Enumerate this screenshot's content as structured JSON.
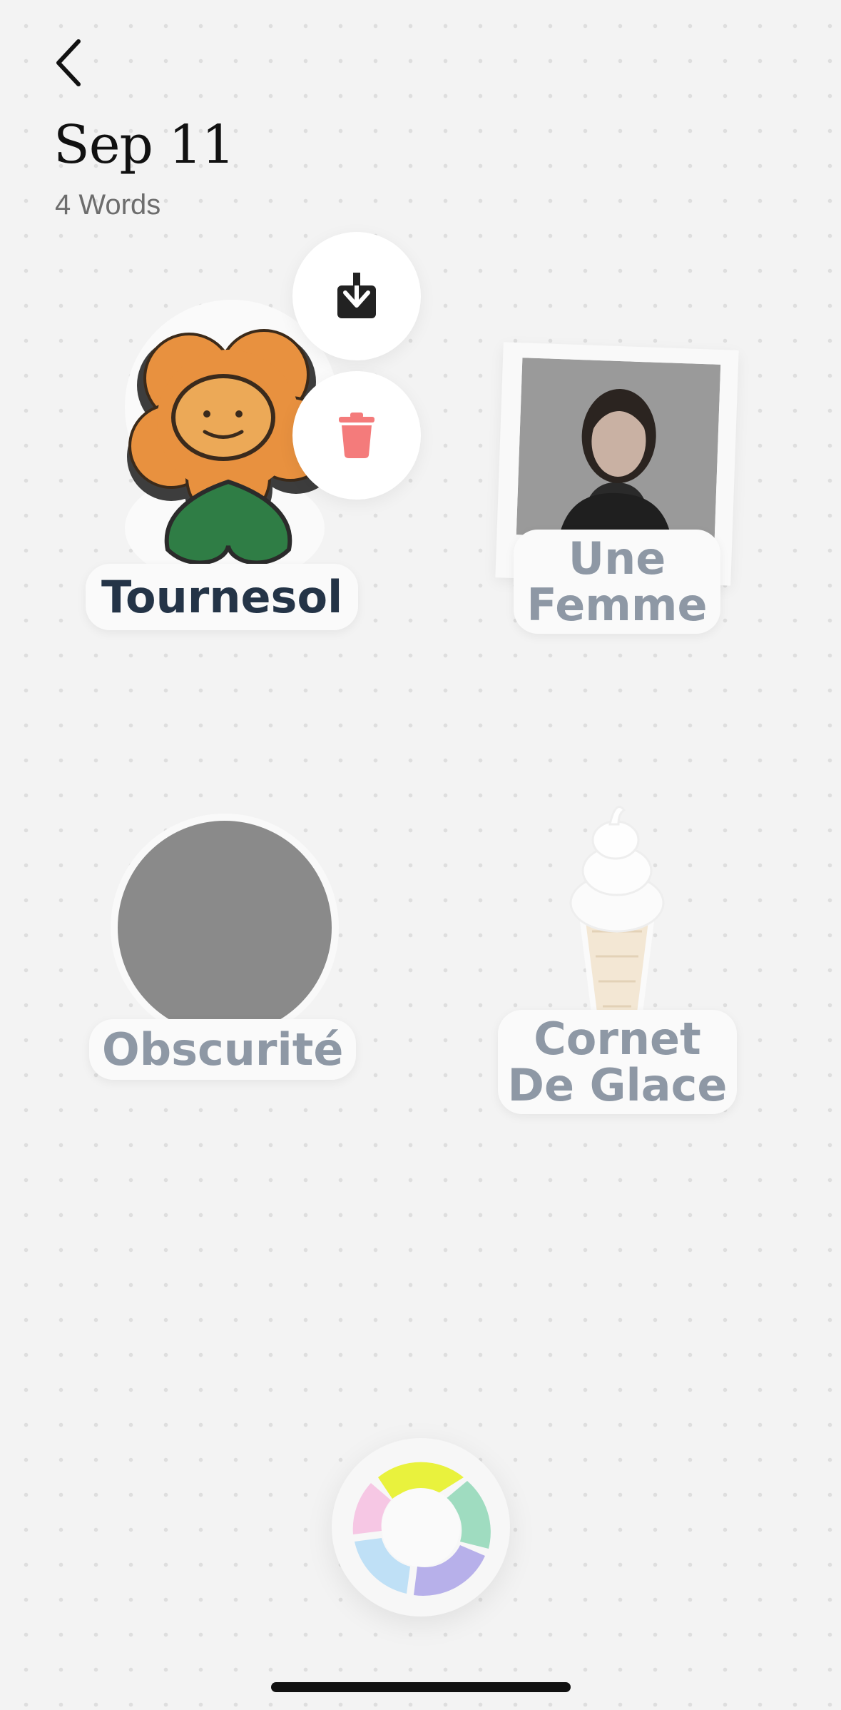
{
  "header": {
    "back_icon": "chevron-left-icon",
    "title": "Sep 11",
    "word_count": "4 Words"
  },
  "stickers": [
    {
      "label": "Tournesol",
      "image": "flower-sticker",
      "active": true
    },
    {
      "label": "Une Femme",
      "label_line1": "Une",
      "label_line2": "Femme",
      "image": "portrait-photo"
    },
    {
      "label": "Obscurité",
      "image": "gray-circle"
    },
    {
      "label": "Cornet De Glace",
      "label_line1": "Cornet",
      "label_line2": "De Glace",
      "image": "ice-cream-cone"
    }
  ],
  "actions": {
    "download_icon": "download-icon",
    "delete_icon": "trash-icon"
  },
  "capture_button": {
    "icon": "shutter-aperture-icon"
  },
  "colors": {
    "background": "#f3f3f3",
    "label_active": "#243447",
    "label_dimmed": "#8e98a5",
    "delete_red": "#f47b7b",
    "aperture_yellow": "#e9f23d",
    "aperture_green": "#9fdcc0",
    "aperture_purple": "#b7b0ea",
    "aperture_blue": "#bfe0f6",
    "aperture_pink": "#f6c7e4"
  }
}
